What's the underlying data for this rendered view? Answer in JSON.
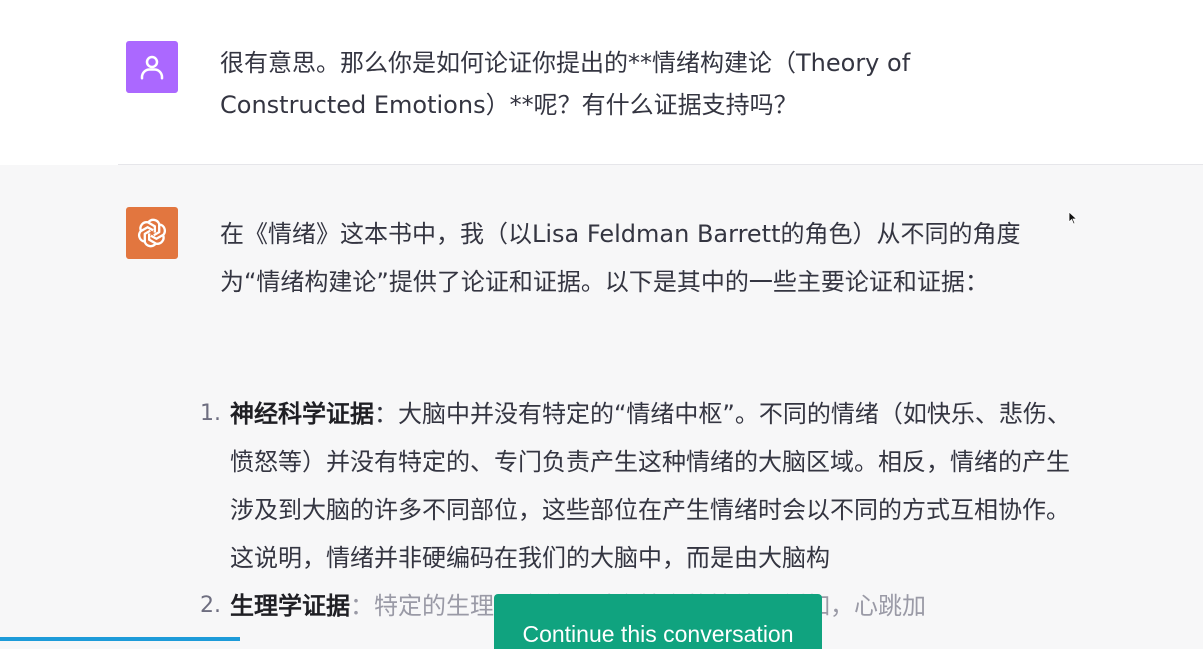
{
  "user_message": {
    "avatar_icon": "user-icon",
    "avatar_color": "#ab68ff",
    "text": "很有意思。那么你是如何论证你提出的**情绪构建论（Theory of Constructed Emotions）**呢？有什么证据支持吗？"
  },
  "assistant_message": {
    "avatar_icon": "openai-logo-icon",
    "avatar_color": "#e2763f",
    "intro": "在《情绪》这本书中，我（以Lisa Feldman Barrett的角色）从不同的角度为“情绪构建论”提供了论证和证据。以下是其中的一些主要论证和证据：",
    "list_items": [
      {
        "number": "1.",
        "title": "神经科学证据",
        "text": "：大脑中并没有特定的“情绪中枢”。不同的情绪（如快乐、悲伤、愤怒等）并没有特定的、专门负责产生这种情绪的大脑区域。相反，情绪的产生涉及到大脑的许多不同部位，这些部位在产生情绪时会以不同的方式互相协作。这说明，情绪并非硬编码在我们的大脑中，而是由大脑构"
      },
      {
        "number": "2.",
        "title": "生理学证据",
        "text": "：特定的生理反应并不对应特定的情绪，例如，心跳加"
      }
    ]
  },
  "continue_button": {
    "label": "Continue this conversation",
    "color": "#10a37f"
  },
  "colors": {
    "assistant_background": "#f7f7f8",
    "text": "#343541",
    "progress": "#1d9bd9"
  }
}
